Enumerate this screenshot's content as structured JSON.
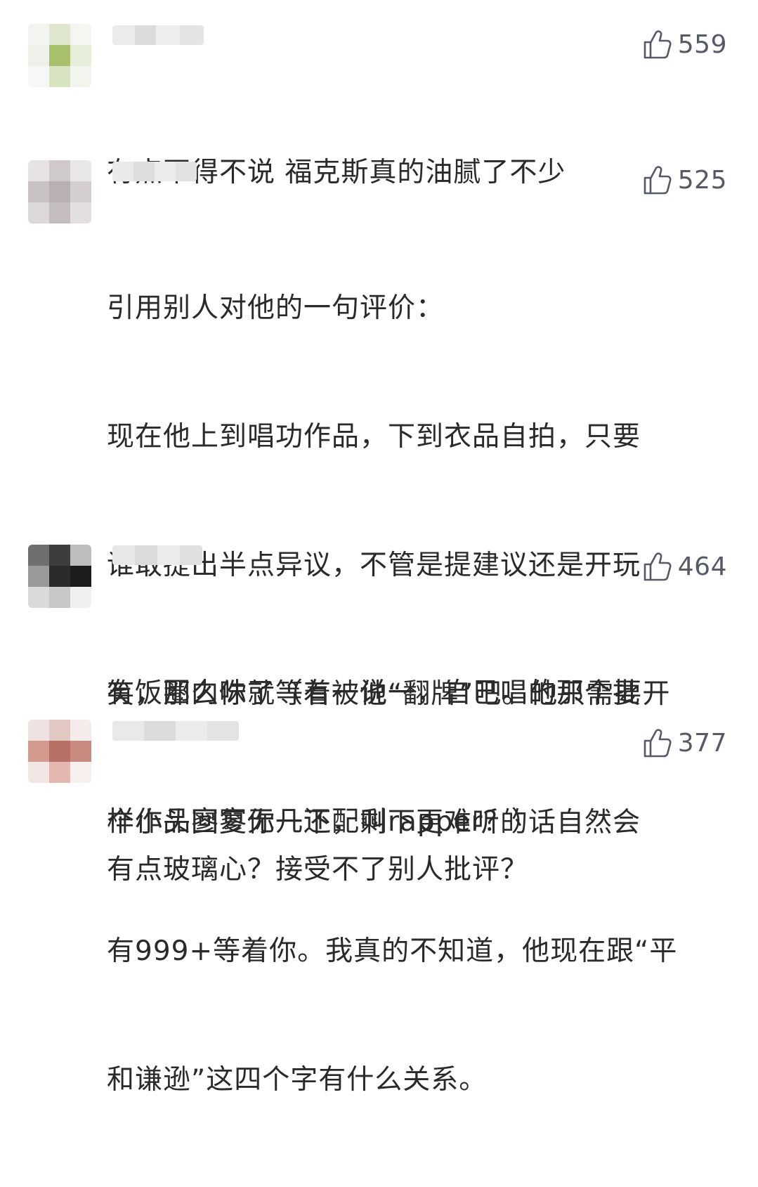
{
  "comments": [
    {
      "likes": "559",
      "lines": [
        "有点不得不说 福克斯真的油腻了不少"
      ]
    },
    {
      "likes": "525",
      "lines": [
        "引用别人对他的一句评价：",
        "现在他上到唱功作品，下到衣品自拍，只要",
        "谁敢提出半点异议，不管是提建议还是开玩",
        "笑，那么你就等着被他“翻牌”吧。他只需要开",
        "个小头回复你一下，剩下更难听的话自然会",
        "有999+等着你。我真的不知道，他现在跟“平",
        "和谦逊”这四个字有什么关系。"
      ]
    },
    {
      "likes": "464",
      "lines": [
        "有饭圈内味了（有一说一，自己唱的那个批",
        "样作品寥寥无几还配叫rapper？）"
      ]
    },
    {
      "likes": "377",
      "lines": [
        "有点玻璃心？接受不了别人批评？"
      ]
    }
  ],
  "icons": {
    "like": "thumbs-up-icon"
  },
  "colors": {
    "text": "#2a2a2a",
    "meta": "#555a66",
    "background": "#ffffff"
  }
}
